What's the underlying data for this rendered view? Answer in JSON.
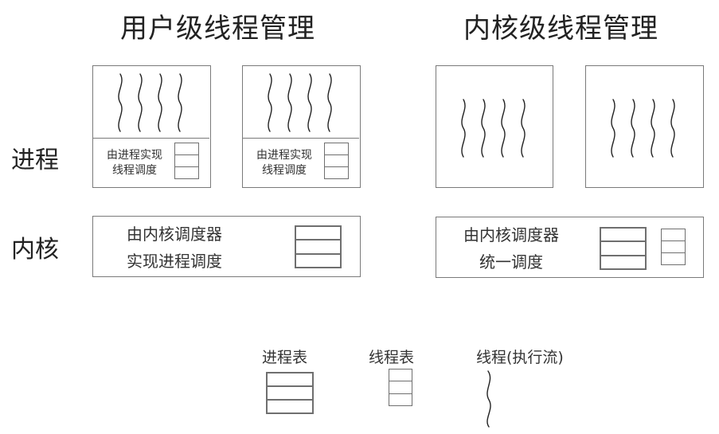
{
  "headings": {
    "user_level": "用户级线程管理",
    "kernel_level": "内核级线程管理"
  },
  "row_labels": {
    "process": "进程",
    "kernel": "内核"
  },
  "user_level": {
    "process_caption_line1": "由进程实现",
    "process_caption_line2": "线程调度",
    "kernel_caption_line1": "由内核调度器",
    "kernel_caption_line2": "实现进程调度"
  },
  "kernel_level": {
    "kernel_caption_line1": "由内核调度器",
    "kernel_caption_line2": "统一调度"
  },
  "legend": {
    "process_table": "进程表",
    "thread_table": "线程表",
    "thread": "线程(执行流)"
  },
  "icons": {
    "thread": "wavy-line-icon",
    "process_table": "three-row-table-icon",
    "thread_table": "three-row-table-icon"
  }
}
